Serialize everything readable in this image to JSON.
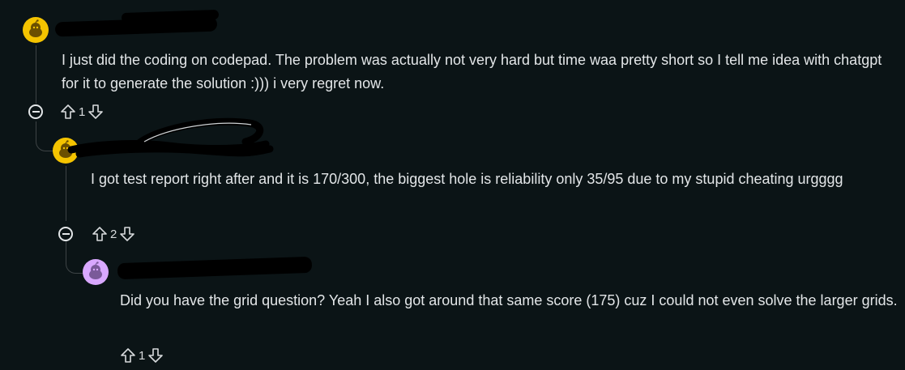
{
  "comments": [
    {
      "avatar_color": "#f5c400",
      "body": "I just did the coding on codepad. The problem was actually not very hard but time waa pretty short so I tell me idea with chatgpt for it to generate the solution :))) i very regret now.",
      "vote_count": "1",
      "collapse_icon": "minus-circle-icon",
      "upvote_icon": "arrow-up-outline-icon",
      "downvote_icon": "arrow-down-outline-icon"
    },
    {
      "avatar_color": "#f5c400",
      "body": "I got test report right after and it is 170/300, the biggest hole is reliability only 35/95 due to my stupid cheating urgggg",
      "vote_count": "2",
      "collapse_icon": "minus-circle-icon",
      "upvote_icon": "arrow-up-outline-icon",
      "downvote_icon": "arrow-down-outline-icon"
    },
    {
      "avatar_color": "#d9a8ff",
      "body": "Did you have the grid question? Yeah I also got around that same score (175) cuz I could not even solve the larger grids.",
      "vote_count": "1",
      "upvote_icon": "arrow-up-outline-icon",
      "downvote_icon": "arrow-down-outline-icon"
    }
  ]
}
